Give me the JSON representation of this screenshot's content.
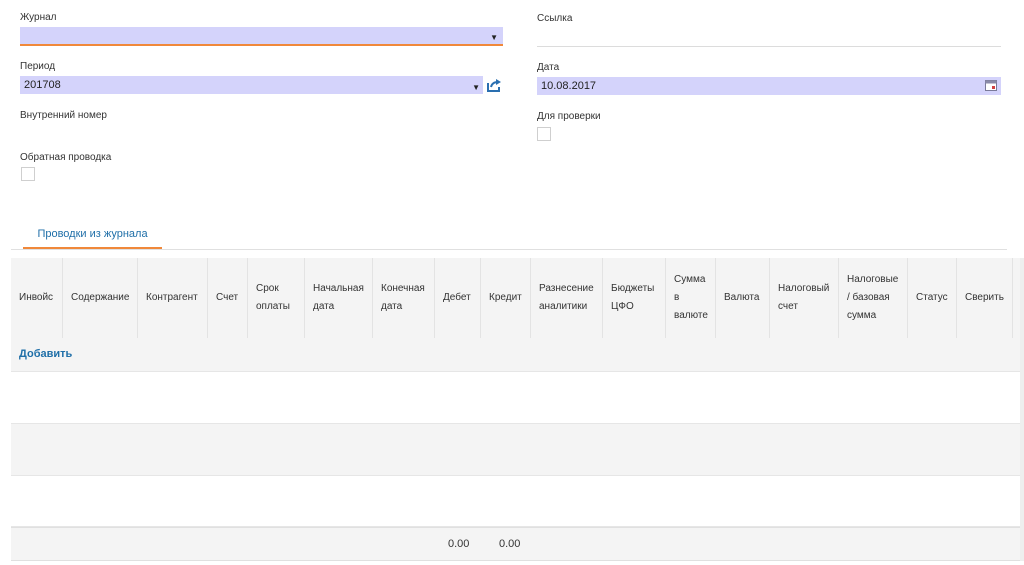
{
  "form": {
    "journal_label": "Журнал",
    "journal_value": "",
    "link_label": "Ссылка",
    "period_label": "Период",
    "period_value": "201708",
    "date_label": "Дата",
    "date_value": "10.08.2017",
    "internal_number_label": "Внутренний номер",
    "for_check_label": "Для проверки",
    "reverse_entry_label": "Обратная проводка"
  },
  "tabs": [
    {
      "label": "Проводки из журнала",
      "active": true
    }
  ],
  "grid": {
    "columns": [
      "Инвойс",
      "Содержание",
      "Контрагент",
      "Счет",
      "Срок оплаты",
      "Начальная дата",
      "Конечная дата",
      "Дебет",
      "Кредит",
      "Разнесение аналитики",
      "Бюджеты ЦФО",
      "Сумма в валюте",
      "Валюта",
      "Налоговый счет",
      "Налоговые / базовая сумма",
      "Статус",
      "Сверить"
    ],
    "add_label": "Добавить",
    "totals": {
      "debit": "0.00",
      "credit": "0.00"
    }
  },
  "colors": {
    "field_bg": "#d4d3fb",
    "accent_orange": "#f0883a",
    "link_blue": "#1f6fa8",
    "icon_blue": "#2a6fb0"
  }
}
